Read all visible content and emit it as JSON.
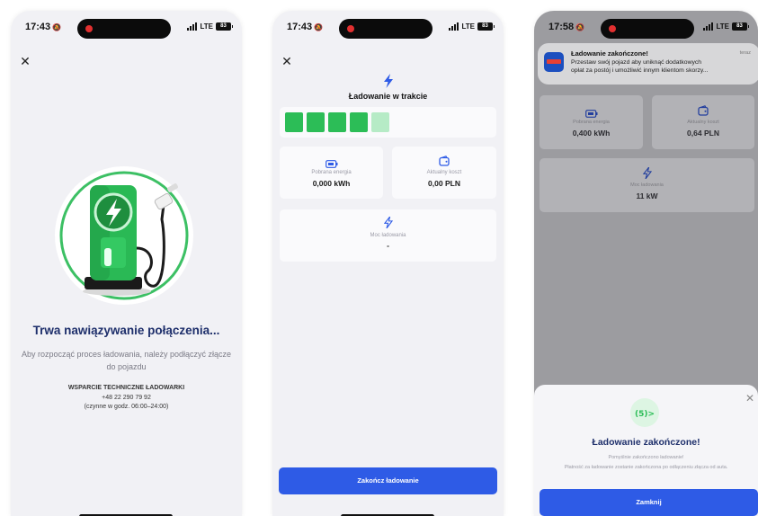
{
  "colors": {
    "brand_navy": "#1e2f6b",
    "accent_green": "#2cbd57",
    "primary_button": "#2e5be6",
    "dim_overlay": "#9c9ca0"
  },
  "screen1": {
    "status": {
      "time": "17:43",
      "network": "LTE",
      "battery": "83"
    },
    "title": "Trwa nawiązywanie połączenia...",
    "subtitle": "Aby rozpocząć proces ładowania, należy podłączyć złącze do pojazdu",
    "support": {
      "label": "WSPARCIE TECHNICZNE ŁADOWARKI",
      "phone": "+48 22 290 79 92",
      "hours": "(czynne w godz. 06:00–24:00)"
    }
  },
  "screen2": {
    "status": {
      "time": "17:43",
      "network": "LTE",
      "battery": "83"
    },
    "title": "Ładowanie w trakcie",
    "progress_segments": {
      "filled": 4,
      "partial": 1
    },
    "energy_label": "Pobrana energia",
    "energy_value": "0,000 kWh",
    "cost_label": "Aktualny koszt",
    "cost_value": "0,00 PLN",
    "power_label": "Moc ładowania",
    "power_value": "-",
    "end_button": "Zakończ ładowanie"
  },
  "screen3": {
    "status": {
      "time": "17:58",
      "network": "LTE",
      "battery": "83"
    },
    "notification": {
      "title": "Ładowanie zakończone!",
      "time": "teraz",
      "body_line1": "Przestaw swój pojazd aby uniknąć dodatkowych",
      "body_line2": "opłat za postój i umożliwić innym klientom skorzy..."
    },
    "energy_label": "Pobrana energia",
    "energy_value": "0,400 kWh",
    "cost_label": "Aktualny koszt",
    "cost_value": "0,64 PLN",
    "power_label": "Moc ładowania",
    "power_value": "11 kW",
    "sheet": {
      "icon_text": "(5)>",
      "title": "Ładowanie zakończone!",
      "subtitle": "Pomyślnie zakończono ładowanie!",
      "description": "Płatność za ładowanie zostanie zakończona po odłączeniu złącza od auta.",
      "close_button": "Zamknij"
    }
  }
}
